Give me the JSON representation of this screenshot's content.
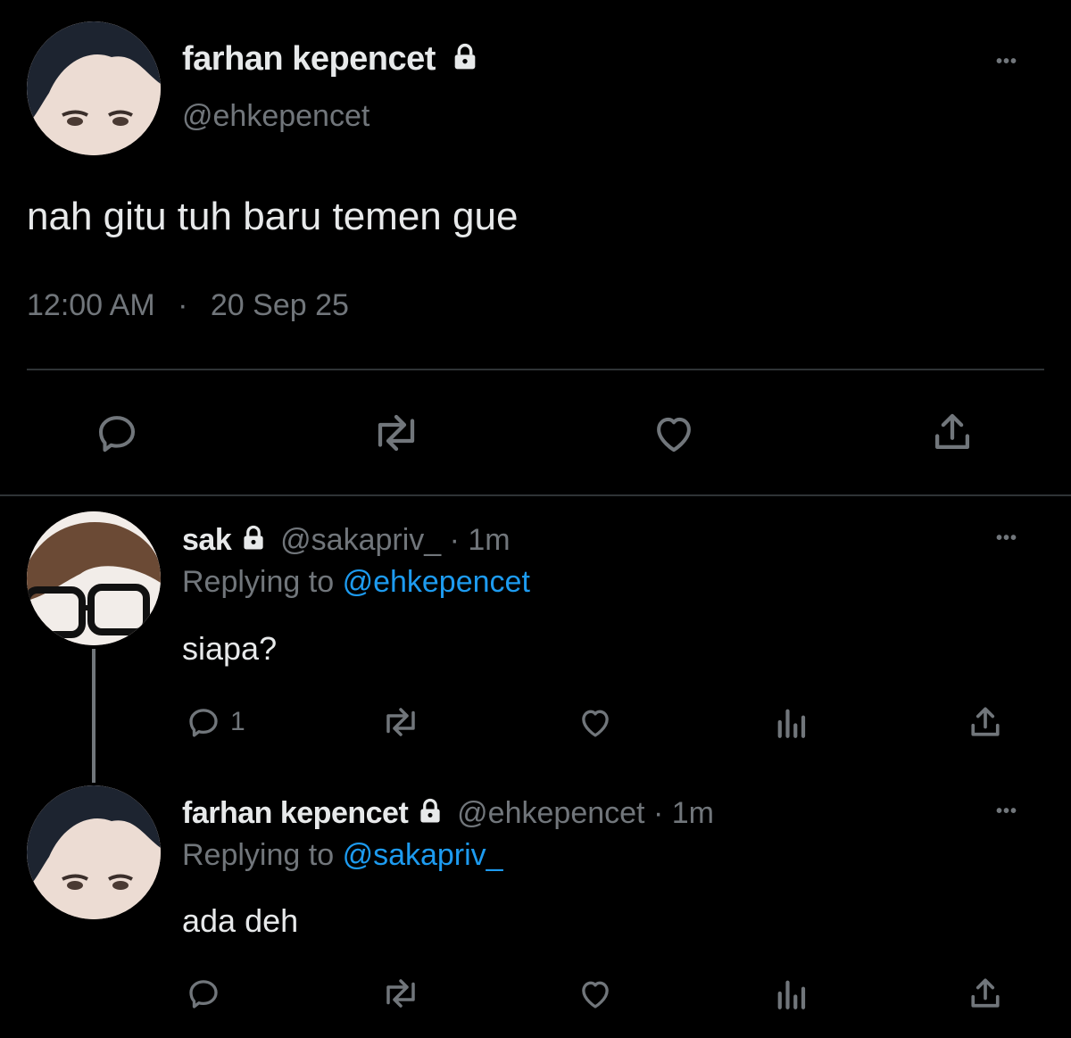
{
  "main_tweet": {
    "display_name": "farhan kepencet",
    "handle": "@ehkepencet",
    "text": "nah gitu tuh baru temen gue",
    "time": "12:00 AM",
    "separator": "·",
    "date": "20 Sep 25",
    "more": "•••"
  },
  "replies": [
    {
      "display_name": "sak",
      "handle": "@sakapriv_",
      "age": "· 1m",
      "replying_prefix": "Replying to",
      "replying_to": "@ehkepencet",
      "text": "siapa?",
      "reply_count": "1",
      "more": "•••"
    },
    {
      "display_name": "farhan kepencet",
      "handle": "@ehkepencet",
      "age": "· 1m",
      "replying_prefix": "Replying to",
      "replying_to": "@sakapriv_",
      "text": "ada deh",
      "reply_count": "",
      "more": "•••"
    }
  ],
  "colors": {
    "background": "#000000",
    "text": "#e7e9ea",
    "muted": "#71767b",
    "link": "#1d9bf0",
    "divider": "#2f3336"
  },
  "icons": [
    "reply-icon",
    "retweet-icon",
    "like-icon",
    "analytics-icon",
    "share-icon",
    "lock-icon",
    "more-icon"
  ]
}
